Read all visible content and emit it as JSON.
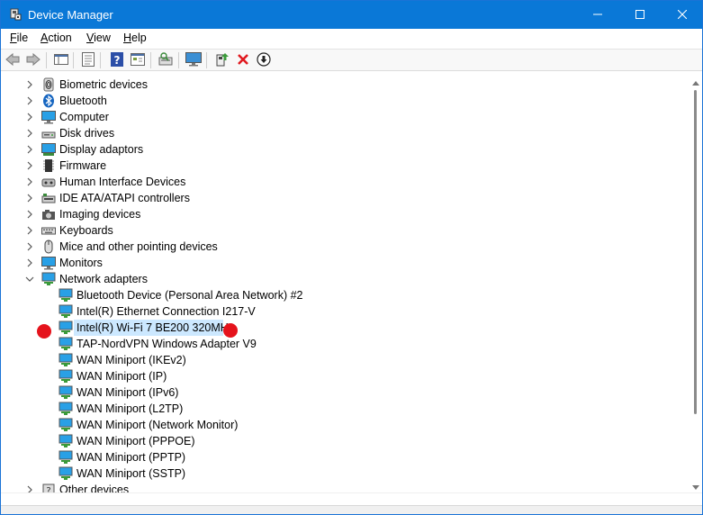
{
  "window": {
    "title": "Device Manager",
    "accent_color": "#0a78d7",
    "controls": [
      "minimize-icon",
      "maximize-icon",
      "close-icon"
    ]
  },
  "menu": {
    "file": {
      "u": "F",
      "rest": "ile"
    },
    "action": {
      "u": "A",
      "rest": "ction"
    },
    "view": {
      "u": "V",
      "rest": "iew"
    },
    "help": {
      "u": "H",
      "rest": "elp"
    }
  },
  "toolbar": {
    "icons": [
      "back-arrow-icon",
      "forward-arrow-icon",
      "show-hide-console-tree-icon",
      "properties-icon",
      "help-icon",
      "view-icon",
      "scan-hardware-changes-icon",
      "monitor-icon",
      "update-driver-icon",
      "uninstall-device-icon",
      "disable-device-icon"
    ]
  },
  "tree": {
    "categories_top": [
      {
        "label": "Biometric devices",
        "icon": "fingerprint-icon"
      },
      {
        "label": "Bluetooth",
        "icon": "bluetooth-icon"
      },
      {
        "label": "Computer",
        "icon": "computer-icon"
      },
      {
        "label": "Disk drives",
        "icon": "disk-drive-icon"
      },
      {
        "label": "Display adaptors",
        "icon": "display-adapter-icon"
      },
      {
        "label": "Firmware",
        "icon": "firmware-chip-icon"
      },
      {
        "label": "Human Interface Devices",
        "icon": "hid-icon"
      },
      {
        "label": "IDE ATA/ATAPI controllers",
        "icon": "ide-controller-icon"
      },
      {
        "label": "Imaging devices",
        "icon": "camera-icon"
      },
      {
        "label": "Keyboards",
        "icon": "keyboard-icon"
      },
      {
        "label": "Mice and other pointing devices",
        "icon": "mouse-icon"
      },
      {
        "label": "Monitors",
        "icon": "monitor-icon"
      }
    ],
    "network_adapters": {
      "label": "Network adapters",
      "icon": "network-adapter-icon",
      "expanded": true,
      "children": [
        "Bluetooth Device (Personal Area Network) #2",
        "Intel(R) Ethernet Connection I217-V",
        "Intel(R) Wi-Fi 7 BE200 320MHz",
        "TAP-NordVPN Windows Adapter V9",
        "WAN Miniport (IKEv2)",
        "WAN Miniport (IP)",
        "WAN Miniport (IPv6)",
        "WAN Miniport (L2TP)",
        "WAN Miniport (Network Monitor)",
        "WAN Miniport (PPPOE)",
        "WAN Miniport (PPTP)",
        "WAN Miniport (SSTP)"
      ],
      "selected_index": 2
    },
    "categories_bottom": [
      {
        "label": "Other devices",
        "icon": "other-devices-icon"
      }
    ]
  },
  "annotations": {
    "marker_color": "#e5131c"
  }
}
